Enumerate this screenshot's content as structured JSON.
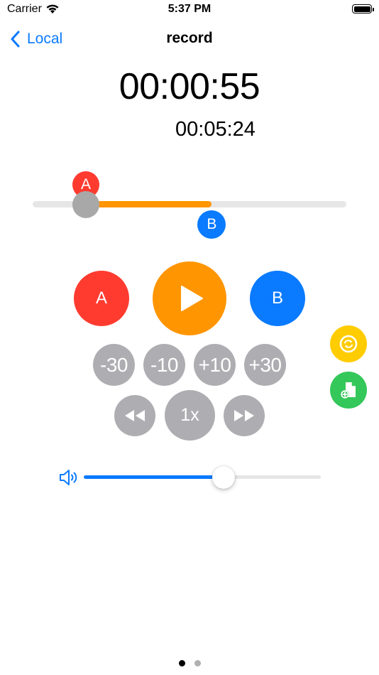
{
  "status_bar": {
    "carrier": "Carrier",
    "time": "5:37 PM"
  },
  "nav": {
    "back_label": "Local",
    "title": "record"
  },
  "timer": {
    "current": "00:00:55",
    "total": "00:05:24"
  },
  "progress": {
    "position_seconds": 55,
    "duration_seconds": 324,
    "marker_a_label": "A",
    "marker_b_label": "B",
    "marker_a_seconds": 55,
    "marker_b_seconds": 185
  },
  "controls": {
    "a_label": "A",
    "b_label": "B",
    "skip_buttons": [
      "-30",
      "-10",
      "+10",
      "+30"
    ],
    "speed_label": "1x"
  },
  "volume": {
    "level": 0.59
  },
  "page_indicator": {
    "count": 2,
    "current": 0
  },
  "colors": {
    "accent_blue": "#0a7aff",
    "orange": "#ff9500",
    "red": "#ff3b30",
    "gray": "#aeaeb2",
    "yellow": "#ffcc00",
    "green": "#34c759"
  },
  "icons": {
    "back": "chevron-left-icon",
    "play": "play-icon",
    "rewind": "rewind-icon",
    "fast_forward": "fast-forward-icon",
    "loop": "loop-icon",
    "add_file": "add-file-icon",
    "volume": "speaker-icon"
  }
}
